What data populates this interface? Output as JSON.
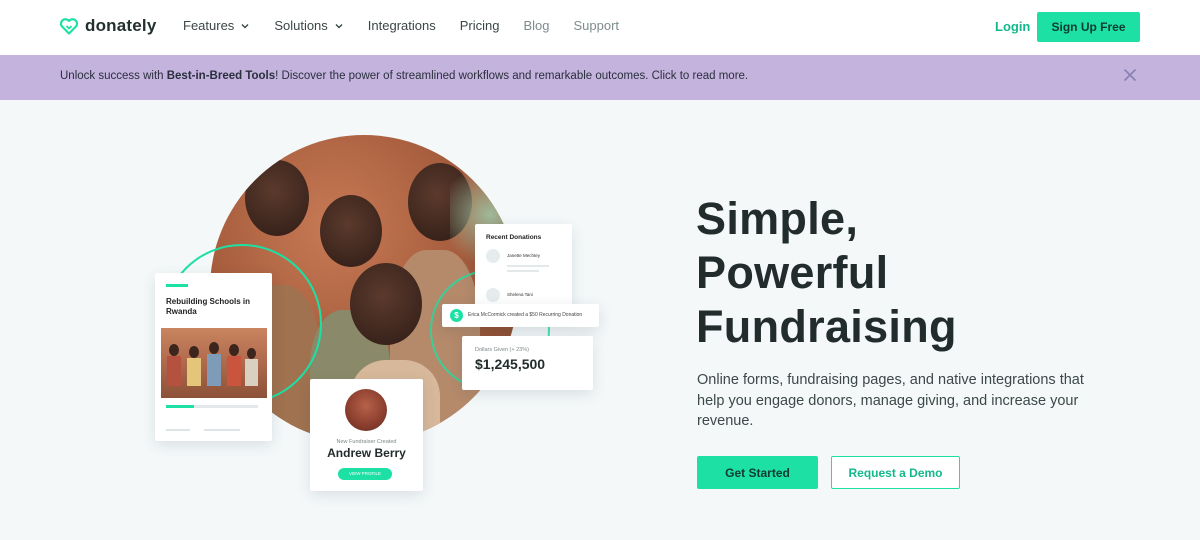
{
  "nav": {
    "logo": "donately",
    "links": [
      {
        "label": "Features",
        "dropdown": true
      },
      {
        "label": "Solutions",
        "dropdown": true
      },
      {
        "label": "Integrations",
        "dropdown": false
      },
      {
        "label": "Pricing",
        "dropdown": false
      },
      {
        "label": "Blog",
        "dropdown": false
      },
      {
        "label": "Support",
        "dropdown": false
      }
    ],
    "login": "Login",
    "signup": "Sign Up Free"
  },
  "banner": {
    "prefix": "Unlock success with ",
    "bold": "Best-in-Breed Tools",
    "suffix": "! Discover the power of streamlined workflows and remarkable outcomes. Click to read more."
  },
  "hero": {
    "headline_1": "Simple,",
    "headline_2": "Powerful",
    "headline_3": "Fundraising",
    "subcopy": "Online forms, fundraising pages, and native integrations that help you engage donors, manage giving, and increase your revenue.",
    "cta_primary": "Get Started",
    "cta_secondary": "Request a Demo"
  },
  "illustration": {
    "school_title": "Rebuilding Schools in Rwanda",
    "recent_title": "Recent Donations",
    "donor_1": "Janette Mechtey",
    "donor_2": "Shelena Tani",
    "toast_text": "Erica McCormick created a $50 Recurring Donation",
    "dollar_label": "Dollars Given (+ 23%)",
    "dollar_value": "$1,245,500",
    "fundraiser_sub": "New Fundraiser Created",
    "fundraiser_name": "Andrew Berry",
    "fundraiser_pill": "VIEW PROFILE",
    "school_progress_percent": 30
  },
  "colors": {
    "accent": "#1de0a4",
    "banner": "#c3b3dd"
  }
}
